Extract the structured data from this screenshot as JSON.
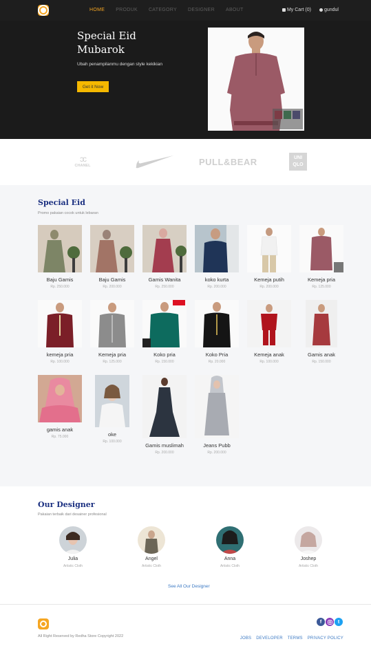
{
  "nav": {
    "items": [
      "HOME",
      "PRODUK",
      "CATEGORY",
      "DESIGNER",
      "ABOUT"
    ],
    "cart": "My Cart (0)",
    "user": "gundul"
  },
  "hero": {
    "title": "Special Eid Mubarok",
    "subtitle": "Ubah penampilanmu dengan style kekikian",
    "button": "Get it Now"
  },
  "brands": {
    "chanel": "CHANEL",
    "pull": "PULL&BEAR",
    "uniqlo_top": "UNI",
    "uniqlo_bottom": "QLO"
  },
  "special": {
    "title": "Special Eid",
    "subtitle": "Promo pakaian cocok untuk lebaran",
    "products": [
      {
        "name": "Baju Gamis",
        "price": "Rp. 250.000"
      },
      {
        "name": "Baju Gamis",
        "price": "Rp. 200.000"
      },
      {
        "name": "Gamis Wanita",
        "price": "Rp. 250.000"
      },
      {
        "name": "koko kurta",
        "price": "Rp. 200.000"
      },
      {
        "name": "Kemeja putih",
        "price": "Rp. 200.000"
      },
      {
        "name": "Kemeja pria",
        "price": "Rp. 125.000"
      },
      {
        "name": "kemeja pria",
        "price": "Rp. 100.000"
      },
      {
        "name": "Kemeja pria",
        "price": "Rp. 125.000"
      },
      {
        "name": "Koko pria",
        "price": "Rp. 150.000"
      },
      {
        "name": "Koko Pria",
        "price": "Rp. 20.000"
      },
      {
        "name": "Kemeja anak",
        "price": "Rp. 100.000"
      },
      {
        "name": "Gamis anak",
        "price": "Rp. 150.000"
      },
      {
        "name": "gamis anak",
        "price": "Rp. 75.000"
      },
      {
        "name": "oke",
        "price": "Rp. 100.000"
      },
      {
        "name": "Gamis muslimah",
        "price": "Rp. 200.000"
      },
      {
        "name": "Jeans Pubb",
        "price": "Rp. 200.000"
      }
    ]
  },
  "designers": {
    "title": "Our Designer",
    "subtitle": "Pakaian terbaik dari desainer profesional",
    "list": [
      {
        "name": "Julia",
        "role": "Artistic Cloth"
      },
      {
        "name": "Angel",
        "role": "Artistic Cloth"
      },
      {
        "name": "Anna",
        "role": "Artistic Cloth"
      },
      {
        "name": "Joshep",
        "role": "Artistic Cloth"
      }
    ],
    "see_all": "See All Our Designer"
  },
  "footer": {
    "copyright": "All Right Reserved by Redha Store Copyright 2022",
    "links": [
      "JOBS",
      "DEVELOPER",
      "TERMS",
      "PRIVACY POLICY"
    ],
    "social_facebook": "f",
    "social_twitter": "t"
  }
}
